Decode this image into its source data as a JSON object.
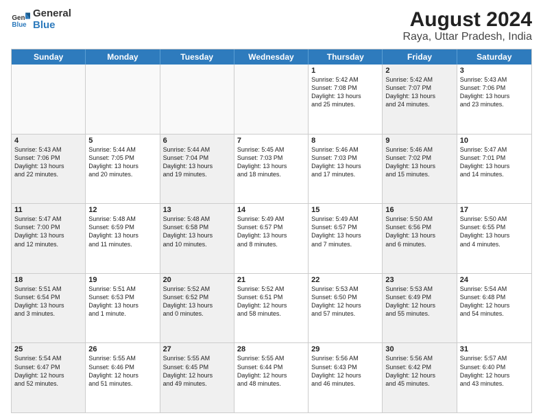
{
  "logo": {
    "line1": "General",
    "line2": "Blue"
  },
  "title": "August 2024",
  "subtitle": "Raya, Uttar Pradesh, India",
  "days": [
    "Sunday",
    "Monday",
    "Tuesday",
    "Wednesday",
    "Thursday",
    "Friday",
    "Saturday"
  ],
  "weeks": [
    [
      {
        "day": "",
        "text": "",
        "empty": true
      },
      {
        "day": "",
        "text": "",
        "empty": true
      },
      {
        "day": "",
        "text": "",
        "empty": true
      },
      {
        "day": "",
        "text": "",
        "empty": true
      },
      {
        "day": "1",
        "text": "Sunrise: 5:42 AM\nSunset: 7:08 PM\nDaylight: 13 hours\nand 25 minutes.",
        "shaded": false
      },
      {
        "day": "2",
        "text": "Sunrise: 5:42 AM\nSunset: 7:07 PM\nDaylight: 13 hours\nand 24 minutes.",
        "shaded": true
      },
      {
        "day": "3",
        "text": "Sunrise: 5:43 AM\nSunset: 7:06 PM\nDaylight: 13 hours\nand 23 minutes.",
        "shaded": false
      }
    ],
    [
      {
        "day": "4",
        "text": "Sunrise: 5:43 AM\nSunset: 7:06 PM\nDaylight: 13 hours\nand 22 minutes.",
        "shaded": true
      },
      {
        "day": "5",
        "text": "Sunrise: 5:44 AM\nSunset: 7:05 PM\nDaylight: 13 hours\nand 20 minutes.",
        "shaded": false
      },
      {
        "day": "6",
        "text": "Sunrise: 5:44 AM\nSunset: 7:04 PM\nDaylight: 13 hours\nand 19 minutes.",
        "shaded": true
      },
      {
        "day": "7",
        "text": "Sunrise: 5:45 AM\nSunset: 7:03 PM\nDaylight: 13 hours\nand 18 minutes.",
        "shaded": false
      },
      {
        "day": "8",
        "text": "Sunrise: 5:46 AM\nSunset: 7:03 PM\nDaylight: 13 hours\nand 17 minutes.",
        "shaded": false
      },
      {
        "day": "9",
        "text": "Sunrise: 5:46 AM\nSunset: 7:02 PM\nDaylight: 13 hours\nand 15 minutes.",
        "shaded": true
      },
      {
        "day": "10",
        "text": "Sunrise: 5:47 AM\nSunset: 7:01 PM\nDaylight: 13 hours\nand 14 minutes.",
        "shaded": false
      }
    ],
    [
      {
        "day": "11",
        "text": "Sunrise: 5:47 AM\nSunset: 7:00 PM\nDaylight: 13 hours\nand 12 minutes.",
        "shaded": true
      },
      {
        "day": "12",
        "text": "Sunrise: 5:48 AM\nSunset: 6:59 PM\nDaylight: 13 hours\nand 11 minutes.",
        "shaded": false
      },
      {
        "day": "13",
        "text": "Sunrise: 5:48 AM\nSunset: 6:58 PM\nDaylight: 13 hours\nand 10 minutes.",
        "shaded": true
      },
      {
        "day": "14",
        "text": "Sunrise: 5:49 AM\nSunset: 6:57 PM\nDaylight: 13 hours\nand 8 minutes.",
        "shaded": false
      },
      {
        "day": "15",
        "text": "Sunrise: 5:49 AM\nSunset: 6:57 PM\nDaylight: 13 hours\nand 7 minutes.",
        "shaded": false
      },
      {
        "day": "16",
        "text": "Sunrise: 5:50 AM\nSunset: 6:56 PM\nDaylight: 13 hours\nand 6 minutes.",
        "shaded": true
      },
      {
        "day": "17",
        "text": "Sunrise: 5:50 AM\nSunset: 6:55 PM\nDaylight: 13 hours\nand 4 minutes.",
        "shaded": false
      }
    ],
    [
      {
        "day": "18",
        "text": "Sunrise: 5:51 AM\nSunset: 6:54 PM\nDaylight: 13 hours\nand 3 minutes.",
        "shaded": true
      },
      {
        "day": "19",
        "text": "Sunrise: 5:51 AM\nSunset: 6:53 PM\nDaylight: 13 hours\nand 1 minute.",
        "shaded": false
      },
      {
        "day": "20",
        "text": "Sunrise: 5:52 AM\nSunset: 6:52 PM\nDaylight: 13 hours\nand 0 minutes.",
        "shaded": true
      },
      {
        "day": "21",
        "text": "Sunrise: 5:52 AM\nSunset: 6:51 PM\nDaylight: 12 hours\nand 58 minutes.",
        "shaded": false
      },
      {
        "day": "22",
        "text": "Sunrise: 5:53 AM\nSunset: 6:50 PM\nDaylight: 12 hours\nand 57 minutes.",
        "shaded": false
      },
      {
        "day": "23",
        "text": "Sunrise: 5:53 AM\nSunset: 6:49 PM\nDaylight: 12 hours\nand 55 minutes.",
        "shaded": true
      },
      {
        "day": "24",
        "text": "Sunrise: 5:54 AM\nSunset: 6:48 PM\nDaylight: 12 hours\nand 54 minutes.",
        "shaded": false
      }
    ],
    [
      {
        "day": "25",
        "text": "Sunrise: 5:54 AM\nSunset: 6:47 PM\nDaylight: 12 hours\nand 52 minutes.",
        "shaded": true
      },
      {
        "day": "26",
        "text": "Sunrise: 5:55 AM\nSunset: 6:46 PM\nDaylight: 12 hours\nand 51 minutes.",
        "shaded": false
      },
      {
        "day": "27",
        "text": "Sunrise: 5:55 AM\nSunset: 6:45 PM\nDaylight: 12 hours\nand 49 minutes.",
        "shaded": true
      },
      {
        "day": "28",
        "text": "Sunrise: 5:55 AM\nSunset: 6:44 PM\nDaylight: 12 hours\nand 48 minutes.",
        "shaded": false
      },
      {
        "day": "29",
        "text": "Sunrise: 5:56 AM\nSunset: 6:43 PM\nDaylight: 12 hours\nand 46 minutes.",
        "shaded": false
      },
      {
        "day": "30",
        "text": "Sunrise: 5:56 AM\nSunset: 6:42 PM\nDaylight: 12 hours\nand 45 minutes.",
        "shaded": true
      },
      {
        "day": "31",
        "text": "Sunrise: 5:57 AM\nSunset: 6:40 PM\nDaylight: 12 hours\nand 43 minutes.",
        "shaded": false
      }
    ]
  ]
}
